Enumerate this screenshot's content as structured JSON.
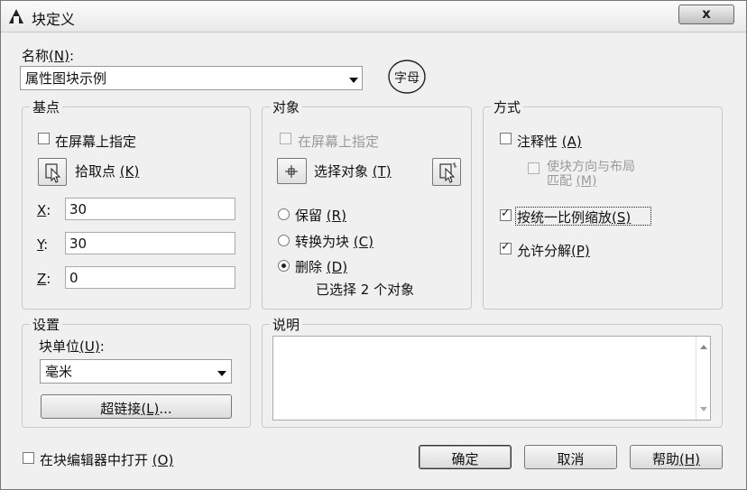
{
  "window": {
    "title": "块定义",
    "close_label": "x"
  },
  "name": {
    "label": "名称",
    "mnemonic": "(N)",
    "colon": ":",
    "value": "属性图块示例",
    "preview_glyph": "字母"
  },
  "base_point": {
    "title": "基点",
    "on_screen_label": "在屏幕上指定",
    "pick_label": "拾取点",
    "pick_mnemonic": "(K)",
    "x_label": "X",
    "y_label": "Y",
    "z_label": "Z",
    "colon": ":",
    "x_value": "30",
    "y_value": "30",
    "z_value": "0"
  },
  "objects": {
    "title": "对象",
    "on_screen_label": "在屏幕上指定",
    "select_label": "选择对象",
    "select_mnemonic": "(T)",
    "retain_label": "保留",
    "retain_mnemonic": "(R)",
    "convert_label": "转换为块",
    "convert_mnemonic": "(C)",
    "delete_label": "删除",
    "delete_mnemonic": "(D)",
    "selected_status": "已选择 2 个对象"
  },
  "behavior": {
    "title": "方式",
    "annotative_label": "注释性",
    "annotative_mnemonic": "(A)",
    "match_orient_label_1": "使块方向与布局",
    "match_orient_label_2": "匹配",
    "match_orient_mnemonic": "(M)",
    "uniform_label": "按统一比例缩放",
    "uniform_mnemonic": "(S)",
    "explode_label": "允许分解",
    "explode_mnemonic": "(P)"
  },
  "settings": {
    "title": "设置",
    "unit_label": "块单位",
    "unit_mnemonic": "(U)",
    "colon": ":",
    "unit_value": "毫米",
    "hyperlink_label": "超链接",
    "hyperlink_mnemonic": "(L)",
    "ellipsis": "..."
  },
  "description": {
    "title": "说明",
    "value": ""
  },
  "footer": {
    "open_editor_label": "在块编辑器中打开",
    "open_editor_mnemonic": "(O)",
    "ok_label": "确定",
    "cancel_label": "取消",
    "help_label": "帮助",
    "help_mnemonic": "(H)"
  }
}
